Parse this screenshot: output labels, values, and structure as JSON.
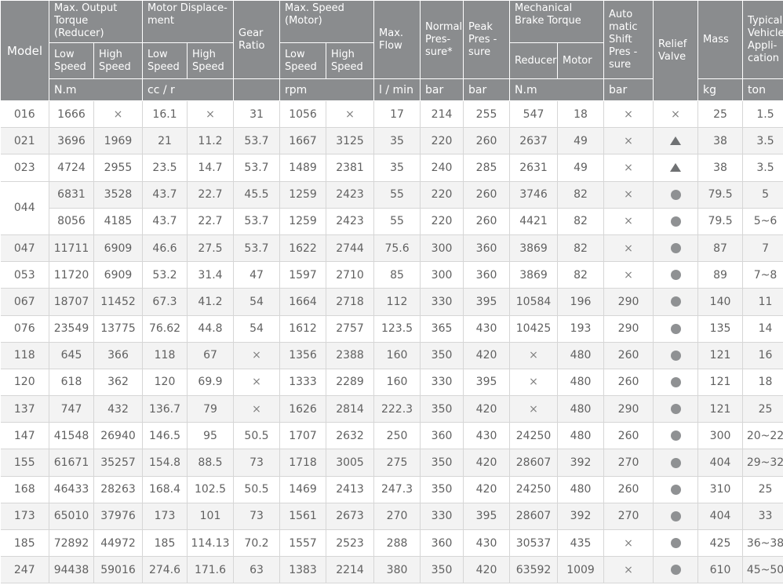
{
  "headers": {
    "model": "Model",
    "torque": "Max. Output Torque (Reducer)",
    "displacement": "Motor Displace-ment",
    "gear_ratio": "Gear Ratio",
    "speed": "Max. Speed (Motor)",
    "max_flow": "Max. Flow",
    "normal_pressure": "Normal Pres- sure*",
    "peak_pressure": "Peak Pres - sure",
    "brake_torque": "Mechanical Brake Torque",
    "auto_shift": "Auto matic Shift Pres - sure",
    "relief_valve": "Relief Valve",
    "mass": "Mass",
    "application": "Typical Vehicle Appli- cation",
    "low_speed": "Low Speed",
    "high_speed": "High Speed",
    "reducer": "Reducer",
    "motor": "Motor"
  },
  "units": {
    "torque": "N.m",
    "displacement": "cc / r",
    "speed": "rpm",
    "flow": "l / min",
    "normal_pressure": "bar",
    "peak_pressure": "bar",
    "brake": "N.m",
    "auto_shift": "bar",
    "mass": "kg",
    "application": "ton"
  },
  "rows": [
    {
      "model": "016",
      "cells": [
        "1666",
        "×",
        "16.1",
        "×",
        "31",
        "1056",
        "×",
        "17",
        "214",
        "255",
        "547",
        "18",
        "×",
        "×",
        "25",
        "1.5"
      ]
    },
    {
      "model": "021",
      "cells": [
        "3696",
        "1969",
        "21",
        "11.2",
        "53.7",
        "1667",
        "3125",
        "35",
        "220",
        "260",
        "2637",
        "49",
        "×",
        "triangle",
        "38",
        "3.5"
      ]
    },
    {
      "model": "023",
      "cells": [
        "4724",
        "2955",
        "23.5",
        "14.7",
        "53.7",
        "1489",
        "2381",
        "35",
        "240",
        "285",
        "2631",
        "49",
        "×",
        "triangle",
        "38",
        "3.5"
      ]
    },
    {
      "model": "044",
      "cells": [
        "6831",
        "3528",
        "43.7",
        "22.7",
        "45.5",
        "1259",
        "2423",
        "55",
        "220",
        "260",
        "3746",
        "82",
        "×",
        "dot",
        "79.5",
        "5"
      ]
    },
    {
      "model": "",
      "cells": [
        "8056",
        "4185",
        "43.7",
        "22.7",
        "53.7",
        "1259",
        "2423",
        "55",
        "220",
        "260",
        "4421",
        "82",
        "×",
        "dot",
        "79.5",
        "5~6"
      ]
    },
    {
      "model": "047",
      "cells": [
        "11711",
        "6909",
        "46.6",
        "27.5",
        "53.7",
        "1622",
        "2744",
        "75.6",
        "300",
        "360",
        "3869",
        "82",
        "×",
        "dot",
        "87",
        "7"
      ]
    },
    {
      "model": "053",
      "cells": [
        "11720",
        "6909",
        "53.2",
        "31.4",
        "47",
        "1597",
        "2710",
        "85",
        "300",
        "360",
        "3869",
        "82",
        "×",
        "dot",
        "89",
        "7~8"
      ]
    },
    {
      "model": "067",
      "cells": [
        "18707",
        "11452",
        "67.3",
        "41.2",
        "54",
        "1664",
        "2718",
        "112",
        "330",
        "395",
        "10584",
        "196",
        "290",
        "dot",
        "140",
        "11"
      ]
    },
    {
      "model": "076",
      "cells": [
        "23549",
        "13775",
        "76.62",
        "44.8",
        "54",
        "1612",
        "2757",
        "123.5",
        "365",
        "430",
        "10425",
        "193",
        "290",
        "dot",
        "135",
        "14"
      ]
    },
    {
      "model": "118",
      "cells": [
        "645",
        "366",
        "118",
        "67",
        "×",
        "1356",
        "2388",
        "160",
        "350",
        "420",
        "×",
        "480",
        "260",
        "dot",
        "121",
        "16"
      ]
    },
    {
      "model": "120",
      "cells": [
        "618",
        "362",
        "120",
        "69.9",
        "×",
        "1333",
        "2289",
        "160",
        "330",
        "395",
        "×",
        "480",
        "260",
        "dot",
        "121",
        "18"
      ]
    },
    {
      "model": "137",
      "cells": [
        "747",
        "432",
        "136.7",
        "79",
        "×",
        "1626",
        "2814",
        "222.3",
        "350",
        "420",
        "×",
        "480",
        "290",
        "dot",
        "121",
        "25"
      ]
    },
    {
      "model": "147",
      "cells": [
        "41548",
        "26940",
        "146.5",
        "95",
        "50.5",
        "1707",
        "2632",
        "250",
        "360",
        "430",
        "24250",
        "480",
        "260",
        "dot",
        "300",
        "20~22"
      ]
    },
    {
      "model": "155",
      "cells": [
        "61671",
        "35257",
        "154.8",
        "88.5",
        "73",
        "1718",
        "3005",
        "275",
        "350",
        "420",
        "28607",
        "392",
        "270",
        "dot",
        "404",
        "29~32"
      ]
    },
    {
      "model": "168",
      "cells": [
        "46433",
        "28263",
        "168.4",
        "102.5",
        "50.5",
        "1469",
        "2413",
        "247.3",
        "350",
        "420",
        "24250",
        "480",
        "260",
        "dot",
        "310",
        "25"
      ]
    },
    {
      "model": "173",
      "cells": [
        "65010",
        "37976",
        "173",
        "101",
        "73",
        "1561",
        "2673",
        "270",
        "330",
        "395",
        "28607",
        "392",
        "270",
        "dot",
        "404",
        "33"
      ]
    },
    {
      "model": "185",
      "cells": [
        "72892",
        "44972",
        "185",
        "114.13",
        "70.2",
        "1557",
        "2523",
        "288",
        "360",
        "430",
        "30537",
        "435",
        "×",
        "dot",
        "425",
        "36~38"
      ]
    },
    {
      "model": "247",
      "cells": [
        "94438",
        "59016",
        "274.6",
        "171.6",
        "63",
        "1383",
        "2214",
        "380",
        "350",
        "420",
        "63592",
        "1009",
        "×",
        "dot",
        "610",
        "45~50"
      ]
    }
  ]
}
